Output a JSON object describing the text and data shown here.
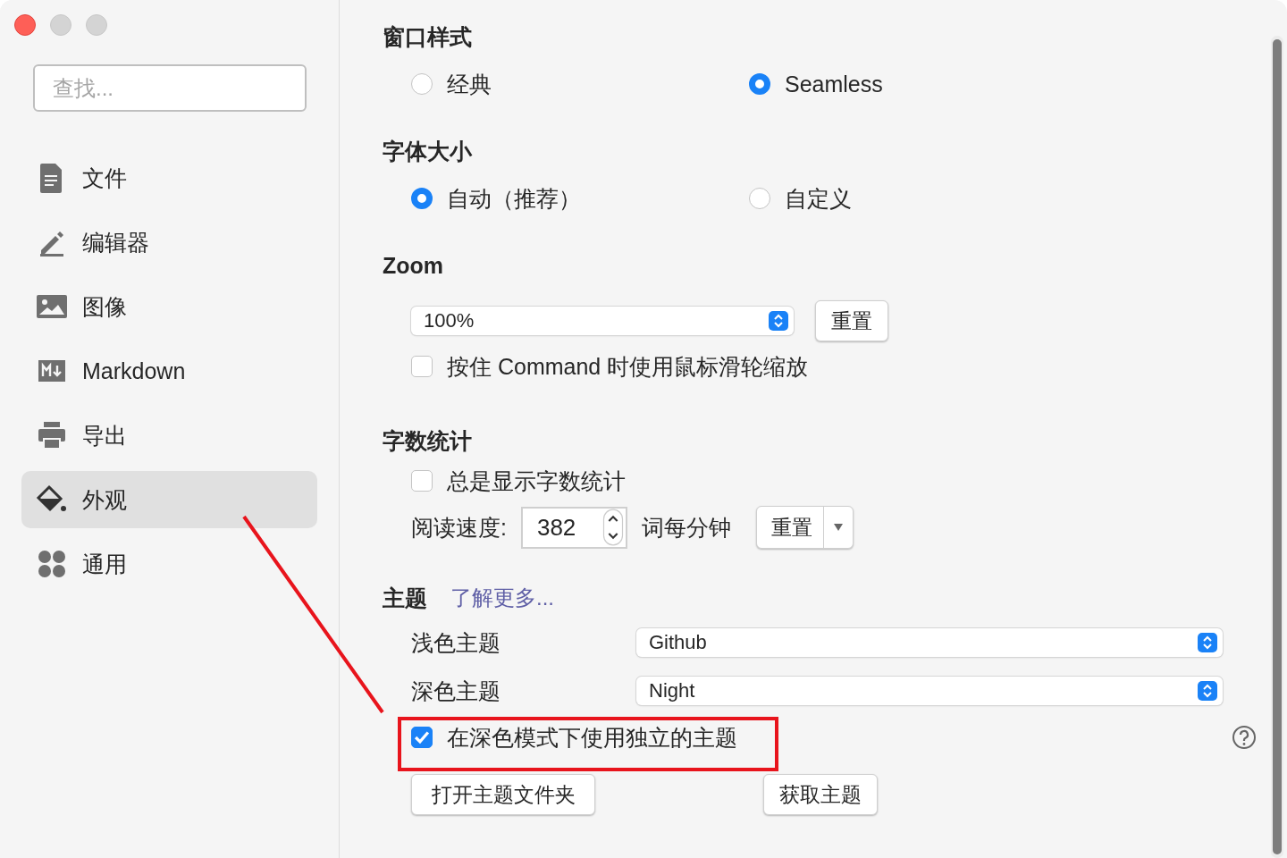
{
  "sidebar": {
    "search": {
      "placeholder": "查找..."
    },
    "items": [
      {
        "label": "文件",
        "selected": false
      },
      {
        "label": "编辑器",
        "selected": false
      },
      {
        "label": "图像",
        "selected": false
      },
      {
        "label": "Markdown",
        "selected": false
      },
      {
        "label": "导出",
        "selected": false
      },
      {
        "label": "外观",
        "selected": true
      },
      {
        "label": "通用",
        "selected": false
      }
    ]
  },
  "window_style": {
    "title": "窗口样式",
    "options": [
      {
        "label": "经典",
        "selected": false
      },
      {
        "label": "Seamless",
        "selected": true
      }
    ]
  },
  "font_size": {
    "title": "字体大小",
    "options": [
      {
        "label": "自动（推荐）",
        "selected": true
      },
      {
        "label": "自定义",
        "selected": false
      }
    ]
  },
  "zoom": {
    "title": "Zoom",
    "value": "100%",
    "reset": "重置",
    "scroll_zoom": {
      "label": "按住 Command 时使用鼠标滑轮缩放",
      "checked": false
    }
  },
  "word_count": {
    "title": "字数统计",
    "always_show": {
      "label": "总是显示字数统计",
      "checked": false
    },
    "speed_label": "阅读速度:",
    "speed_value": "382",
    "speed_unit": "词每分钟",
    "reset": "重置"
  },
  "theme": {
    "title": "主题",
    "link": "了解更多...",
    "light_label": "浅色主题",
    "light_value": "Github",
    "dark_label": "深色主题",
    "dark_value": "Night",
    "separate": {
      "label": "在深色模式下使用独立的主题",
      "checked": true
    },
    "buttons": [
      "打开主题文件夹",
      "获取主题"
    ]
  }
}
